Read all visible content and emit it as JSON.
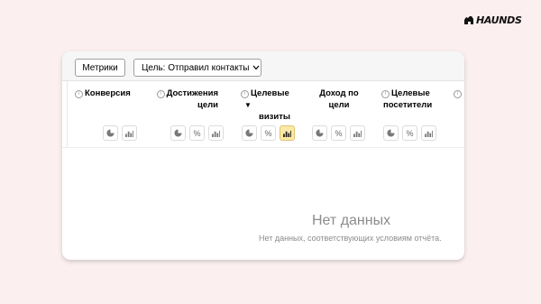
{
  "brand": {
    "logo_text": "HAUNDS"
  },
  "toolbar": {
    "metrics_label": "Метрики",
    "goal_label": "Цель: Отправил контакты"
  },
  "table": {
    "columns": [
      {
        "title_line1": "Конверсия",
        "title_line2": "",
        "info_icon": true,
        "sort": ""
      },
      {
        "title_line1": "Достижения",
        "title_line2": "цели",
        "info_icon": true,
        "sort": ""
      },
      {
        "title_line1": "Целевые",
        "title_line2": "визиты",
        "info_icon": true,
        "sort": "▼"
      },
      {
        "title_line1": "Доход по",
        "title_line2": "цели",
        "info_icon": false,
        "sort": ""
      },
      {
        "title_line1": "Целевые",
        "title_line2": "посетители",
        "info_icon": true,
        "sort": ""
      }
    ]
  },
  "empty_state": {
    "title": "Нет данных",
    "subtitle": "Нет данных, соответствующих условиям отчёта."
  }
}
